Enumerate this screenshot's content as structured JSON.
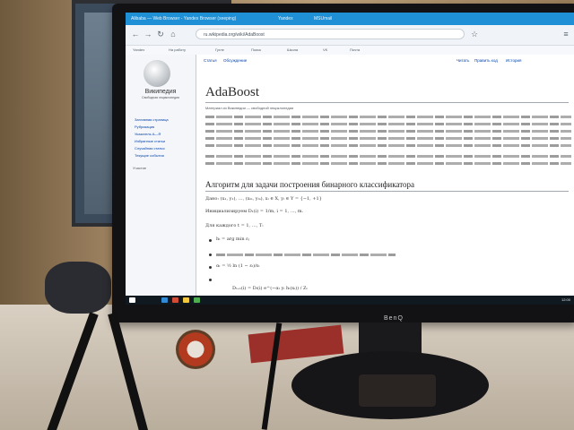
{
  "browser": {
    "tabs": [
      "Alibaba — Web Browser - Yandex Browser (xeeping)",
      "Yandex",
      "MSUmail"
    ],
    "address": "ru.wikipedia.org/wiki/AdaBoost",
    "bookmarks": [
      "Yandex",
      "На работу",
      "Гугле",
      "Поиск",
      "Школа",
      "VK",
      "Почта"
    ]
  },
  "wiki": {
    "logo_text": "Википедия",
    "logo_sub": "Свободная энциклопедия",
    "sidebar": [
      "Заглавная страница",
      "Рубрикация",
      "Указатель А—Я",
      "Избранные статьи",
      "Случайная статья",
      "Текущие события"
    ],
    "side_head": "Участие",
    "tabs": [
      "Статья",
      "Обсуждение",
      "Читать",
      "Править код",
      "История"
    ],
    "title": "AdaBoost",
    "tagline": "Материал из Википедии — свободной энциклопедии",
    "section": "Алгоритм для задачи построения бинарного классификатора",
    "formulas": [
      "Дано: (x₁, y₁), …, (xₘ, yₘ), xᵢ ∈ X, yᵢ ∈ Y = {−1, +1}",
      "Инициализируем D₁(i) = 1/m, i = 1, …, m.",
      "Для каждого t = 1, …, T:",
      "hₜ = arg min εⱼ",
      "αₜ = ½ ln (1 − εₜ)/εₜ",
      "Dₜ₊₁(i) = Dₜ(i) e^(−αₜ yᵢ hₜ(xᵢ)) / Zₜ"
    ]
  },
  "monitor_brand": "BenQ",
  "clock": "12:00"
}
